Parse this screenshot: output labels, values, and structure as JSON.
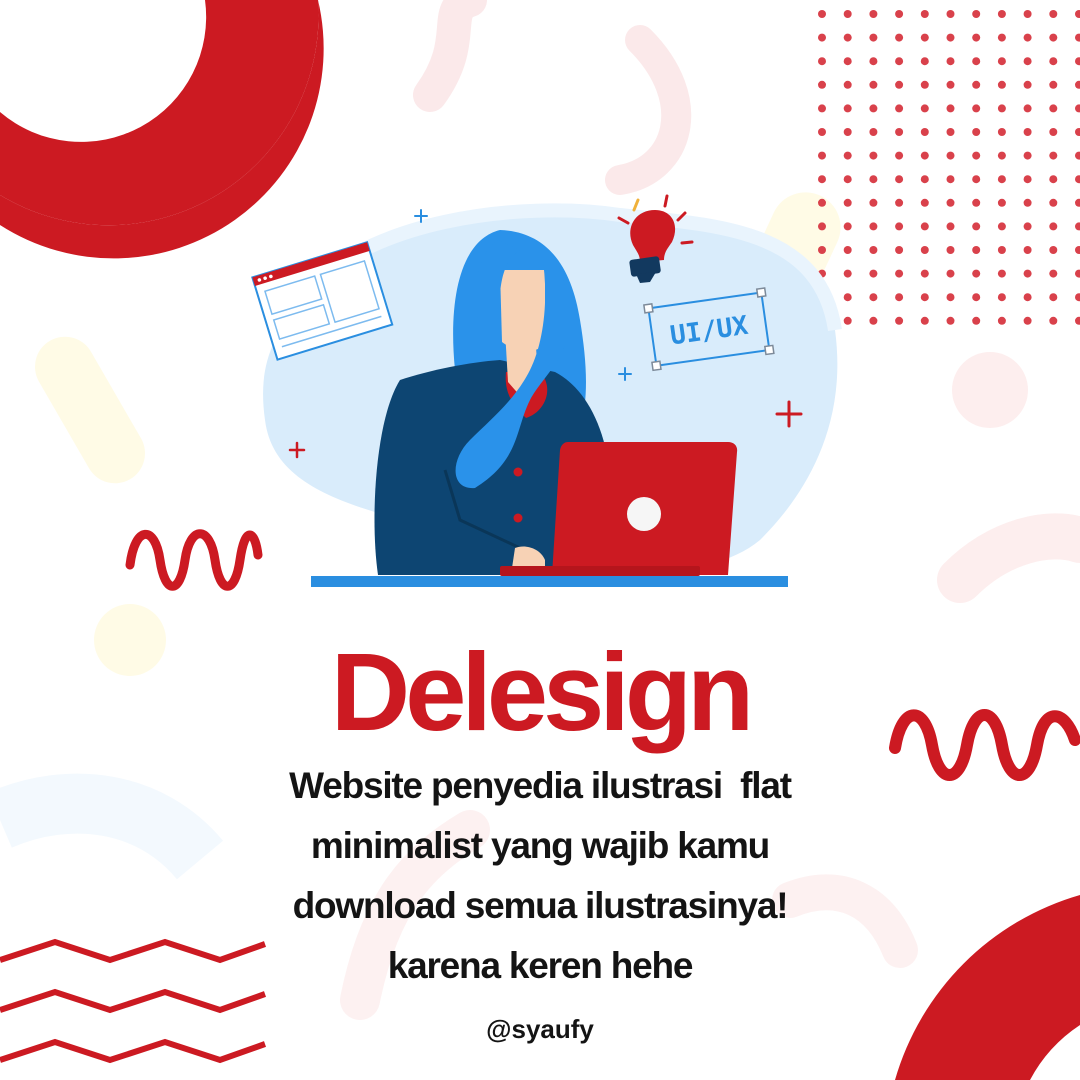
{
  "poster": {
    "headline": "Delesign",
    "description_lines": [
      "Website penyedia ilustrasi  flat",
      "minimalist yang wajib kamu",
      "download semua ilustrasinya!",
      "karena keren hehe"
    ],
    "handle": "@syaufy"
  },
  "illustration": {
    "tag_text": "UI/UX"
  },
  "colors": {
    "brand_red": "#cc1a22",
    "hair_blue": "#2a92ea",
    "jacket_navy": "#0d4572",
    "bubble_blue": "#d9ecfb",
    "dots_red": "#d9414b",
    "text_dark": "#141414"
  }
}
